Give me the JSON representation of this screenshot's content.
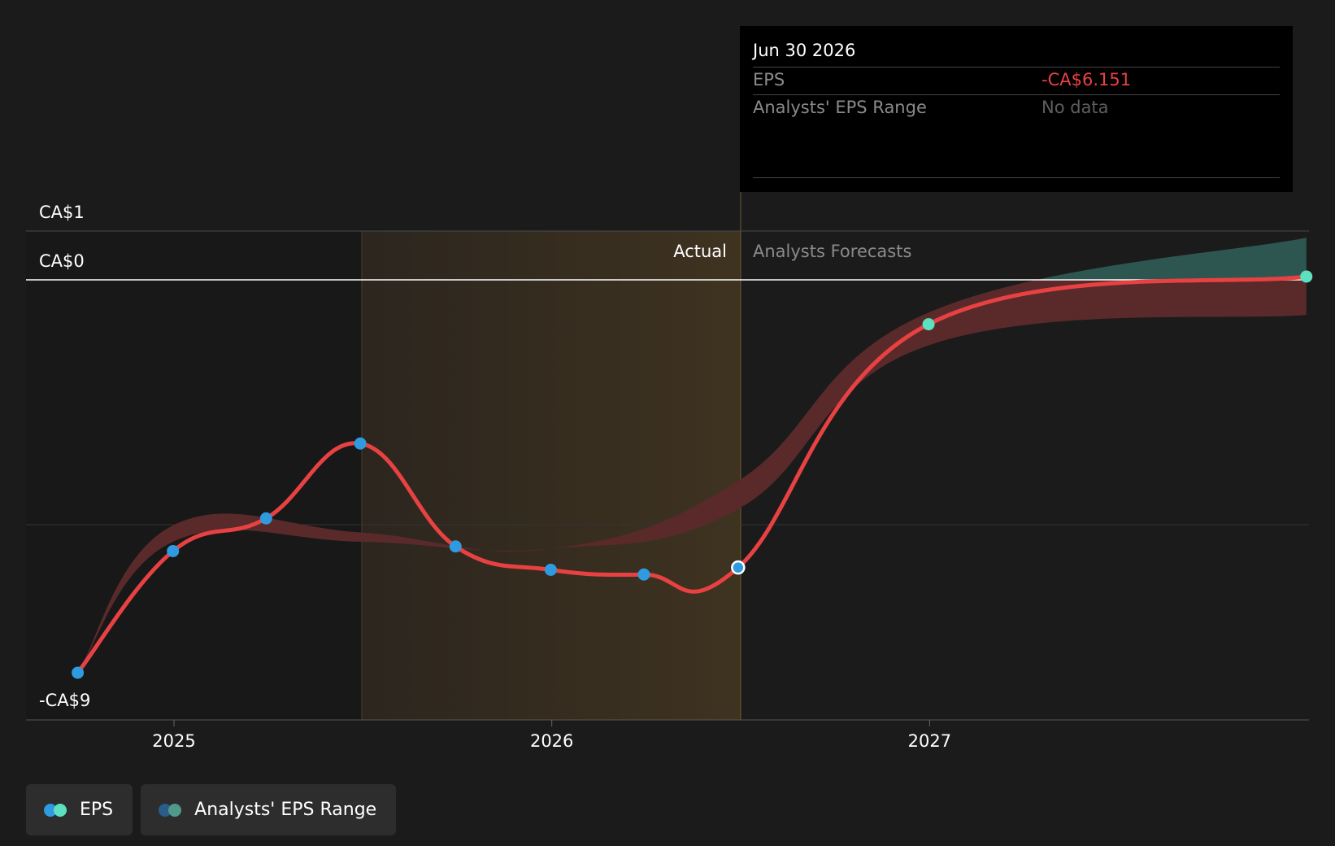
{
  "chart_data": {
    "type": "line",
    "x_axis": {
      "ticks": [
        "2025",
        "2026",
        "2027"
      ]
    },
    "y_axis": {
      "tick_labels": [
        "CA$1",
        "CA$0",
        "-CA$9"
      ],
      "range": [
        -9,
        1
      ]
    },
    "regions": {
      "actual_label": "Actual",
      "forecast_label": "Analysts Forecasts"
    },
    "series": [
      {
        "name": "EPS",
        "points": [
          {
            "x": "2024-09-30",
            "y": -8.4,
            "kind": "actual"
          },
          {
            "x": "2024-12-31",
            "y": -5.8,
            "kind": "actual"
          },
          {
            "x": "2025-03-31",
            "y": -5.1,
            "kind": "actual"
          },
          {
            "x": "2025-06-30",
            "y": -3.5,
            "kind": "actual"
          },
          {
            "x": "2025-09-30",
            "y": -5.7,
            "kind": "actual"
          },
          {
            "x": "2025-12-31",
            "y": -6.2,
            "kind": "actual"
          },
          {
            "x": "2026-03-31",
            "y": -6.3,
            "kind": "actual"
          },
          {
            "x": "2026-06-30",
            "y": -6.151,
            "kind": "actual"
          },
          {
            "x": "2026-12-31",
            "y": -0.95,
            "kind": "forecast"
          },
          {
            "x": "2027-12-31",
            "y": 0.07,
            "kind": "forecast"
          }
        ]
      }
    ],
    "range_series": {
      "name": "Analysts' EPS Range",
      "low": [
        {
          "x": "2024-09-30",
          "y": -8.4
        },
        {
          "x": "2024-12-31",
          "y": -5.6
        },
        {
          "x": "2025-06-30",
          "y": -5.6
        },
        {
          "x": "2025-12-31",
          "y": -5.75
        },
        {
          "x": "2026-06-30",
          "y": -4.9
        },
        {
          "x": "2026-12-31",
          "y": -1.4
        },
        {
          "x": "2027-12-31",
          "y": -0.75
        }
      ],
      "high": [
        {
          "x": "2024-09-30",
          "y": -8.4
        },
        {
          "x": "2024-12-31",
          "y": -5.25
        },
        {
          "x": "2025-06-30",
          "y": -5.4
        },
        {
          "x": "2025-12-31",
          "y": -5.75
        },
        {
          "x": "2026-06-30",
          "y": -4.3
        },
        {
          "x": "2026-12-31",
          "y": -0.7
        },
        {
          "x": "2027-12-31",
          "y": 0.9
        }
      ]
    },
    "colors": {
      "eps_line": "#e84142",
      "actual_marker": "#2f9ae0",
      "forecast_marker": "#5ce0c0",
      "range_fill_negative": "#5a2a2b",
      "range_fill_positive": "#2e5650",
      "highlight_band": "#3a2e1f",
      "zero_line": "#ffffff",
      "grid": "#3a3a3a"
    }
  },
  "tooltip": {
    "date": "Jun 30 2026",
    "eps_label": "EPS",
    "eps_value": "-CA$6.151",
    "range_label": "Analysts' EPS Range",
    "range_value": "No data"
  },
  "legend": {
    "items": [
      {
        "label": "EPS",
        "dot_colors": [
          "#2f9ae0",
          "#5ce0c0"
        ]
      },
      {
        "label": "Analysts' EPS Range",
        "dot_colors": [
          "#2a5e8a",
          "#4f9a8a"
        ]
      }
    ]
  }
}
